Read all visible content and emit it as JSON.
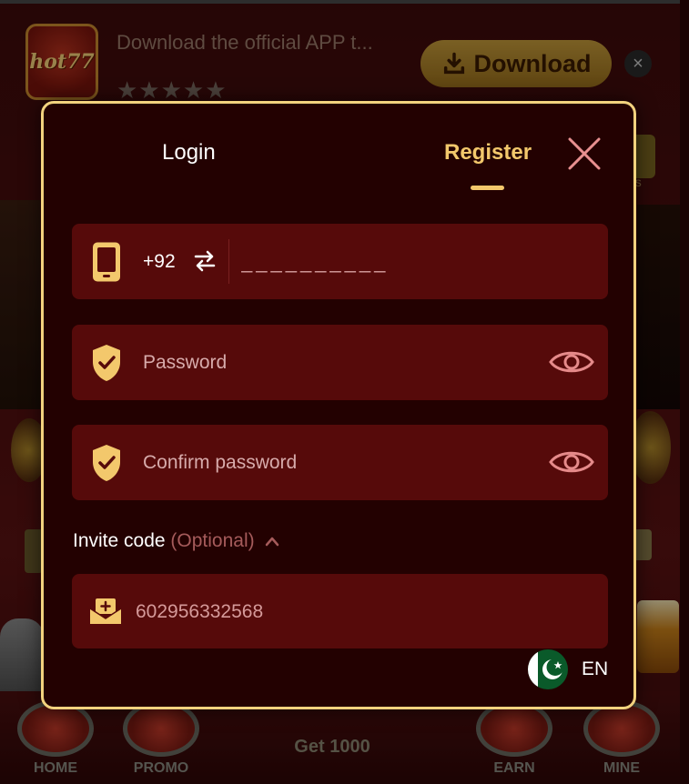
{
  "banner": {
    "logo_text": "hot77",
    "title": "Download the official APP t...",
    "stars": "★★★★★",
    "download_label": "Download",
    "close_glyph": "×"
  },
  "background": {
    "bonus_label": "us"
  },
  "bottom_nav": {
    "items": [
      {
        "label": "HOME",
        "icon": "home-icon"
      },
      {
        "label": "PROMO",
        "icon": "promo-icon"
      },
      {
        "label": "EARN",
        "icon": "earn-icon"
      },
      {
        "label": "MINE",
        "icon": "mine-icon"
      }
    ],
    "center_label": "Get 1000"
  },
  "modal": {
    "tabs": {
      "login": "Login",
      "register": "Register",
      "active": "register"
    },
    "phone": {
      "country_code": "+92",
      "placeholder": "__________"
    },
    "password": {
      "placeholder": "Password"
    },
    "confirm_password": {
      "placeholder": "Confirm password"
    },
    "invite": {
      "label": "Invite code",
      "optional": "(Optional)",
      "value": "602956332568"
    },
    "language": {
      "code": "EN",
      "flag": "pakistan-flag"
    }
  },
  "colors": {
    "accent": "#f3c86c",
    "modal_bg": "#230101",
    "field_bg": "#560a0a",
    "border": "#f2d27e"
  }
}
